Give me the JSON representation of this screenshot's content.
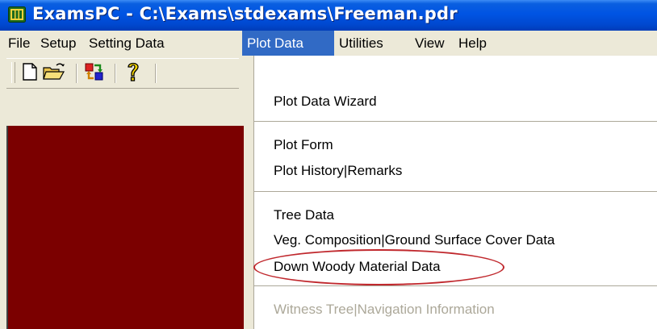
{
  "window": {
    "title": "ExamsPC - C:\\Exams\\stdexams\\Freeman.pdr",
    "client_color": "#7b0000",
    "title_color": "#0054e3"
  },
  "menubar": {
    "items": [
      {
        "label": "File"
      },
      {
        "label": "Setup"
      },
      {
        "label": "Setting Data"
      },
      {
        "label": "Plot Data",
        "active": true
      },
      {
        "label": "Utilities"
      },
      {
        "label": "View"
      },
      {
        "label": "Help"
      }
    ]
  },
  "toolbar": {
    "buttons": [
      {
        "icon": "new-document-icon"
      },
      {
        "icon": "open-folder-icon"
      },
      {
        "icon": "refresh-arrows-icon"
      },
      {
        "icon": "help-question-icon"
      }
    ]
  },
  "dropdown": {
    "items": [
      {
        "label": "Plot Data Wizard"
      },
      {
        "label": "Plot Form"
      },
      {
        "label": "Plot History|Remarks"
      },
      {
        "label": "Tree Data"
      },
      {
        "label": "Veg. Composition|Ground Surface Cover Data"
      },
      {
        "label": "Down Woody Material Data",
        "highlighted": true
      },
      {
        "label": "Witness Tree|Navigation Information",
        "disabled": true
      }
    ],
    "callout_color": "#c0282d"
  }
}
